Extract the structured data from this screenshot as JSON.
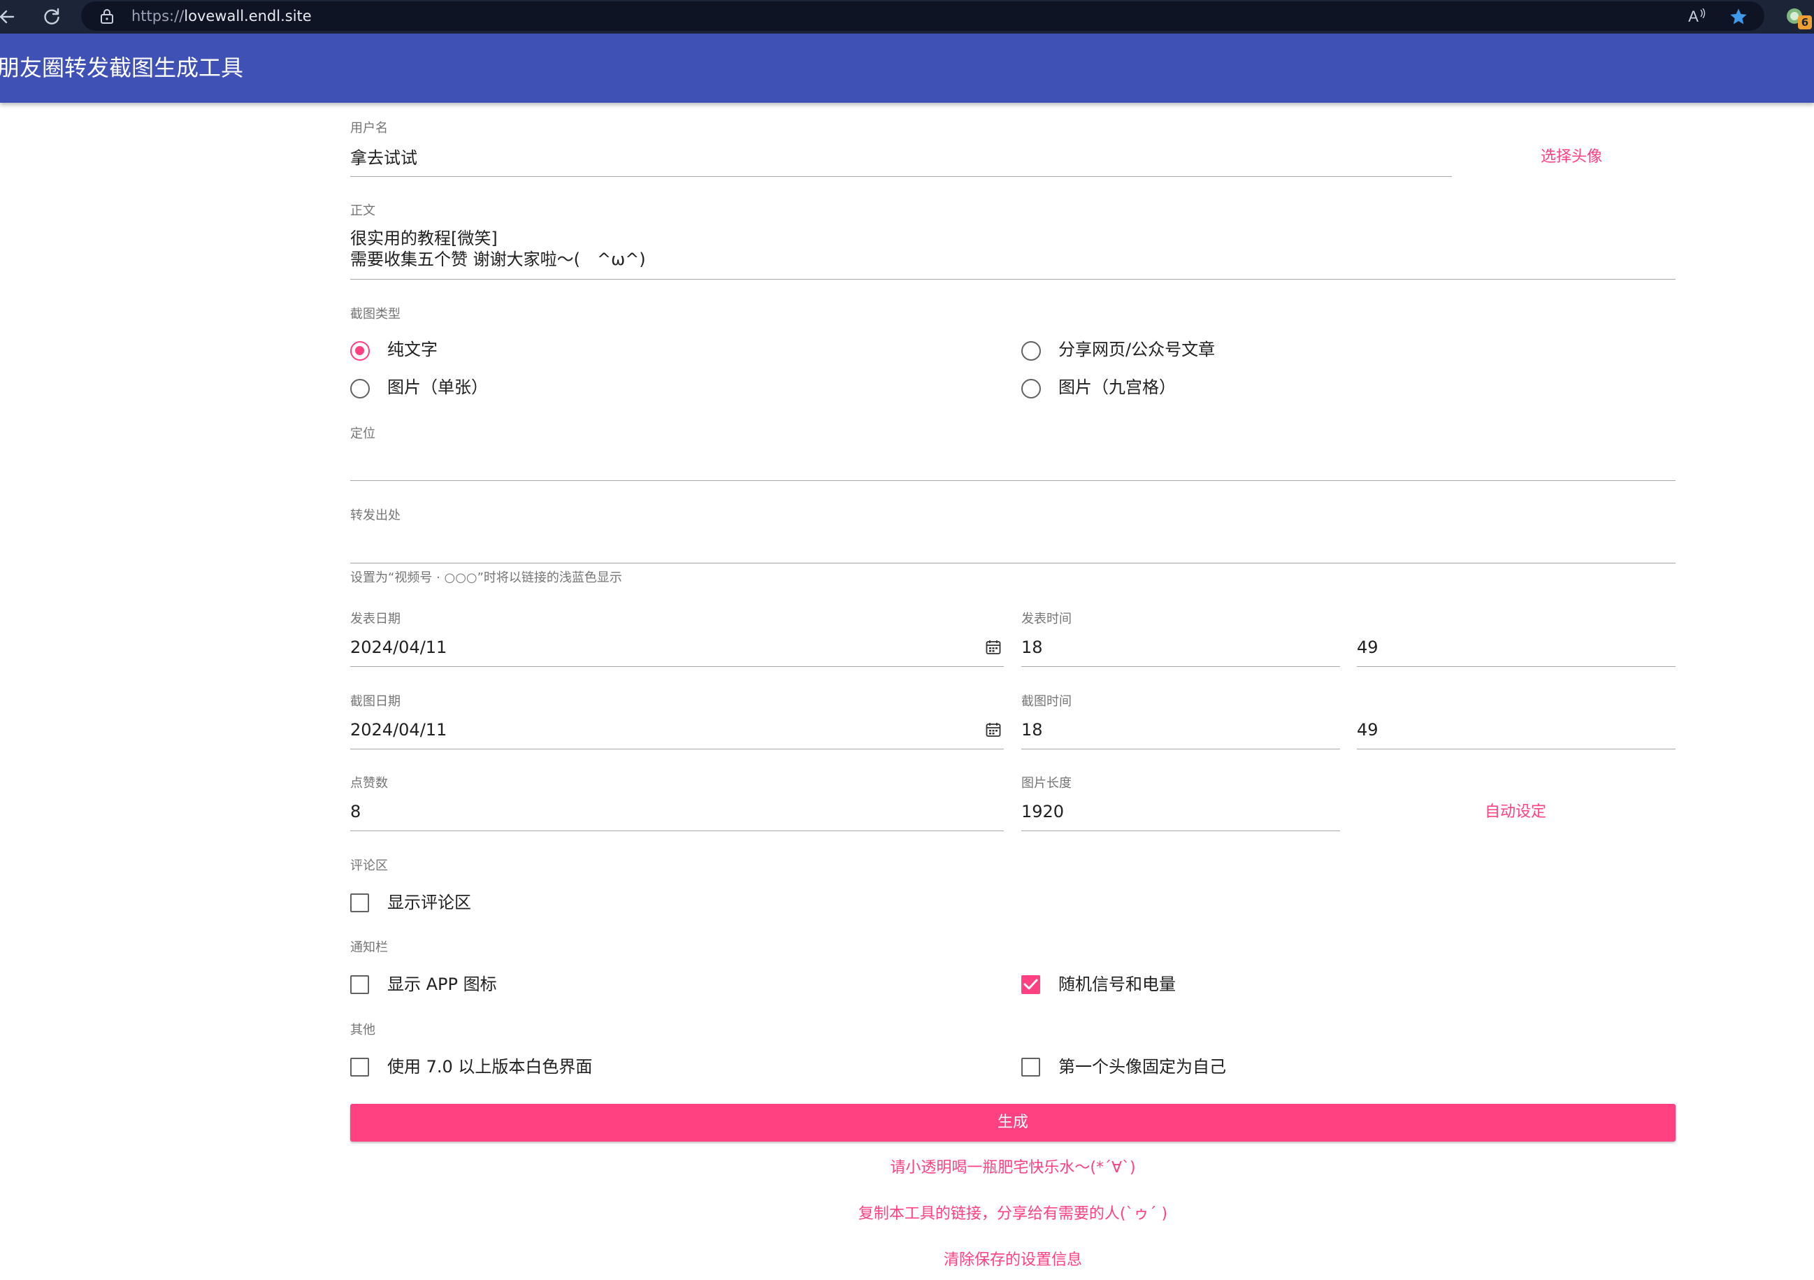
{
  "browser": {
    "url_protocol": "https://",
    "url_host": "lovewall.endl.site",
    "read_aloud_label": "A",
    "extension_badge": "6"
  },
  "app": {
    "title": "朋友圈转发截图生成工具"
  },
  "form": {
    "username": {
      "label": "用户名",
      "value": "拿去试试",
      "avatar_link": "选择头像"
    },
    "content": {
      "label": "正文",
      "line1": "很实用的教程[微笑]",
      "line2": "需要收集五个赞 谢谢大家啦～(　^ω^)"
    },
    "screenshot_type": {
      "label": "截图类型",
      "options": [
        "纯文字",
        "分享网页/公众号文章",
        "图片（单张）",
        "图片（九宫格）"
      ],
      "selected": "纯文字"
    },
    "location": {
      "label": "定位",
      "value": ""
    },
    "source": {
      "label": "转发出处",
      "value": "",
      "helper": "设置为“视频号 · ○○○”时将以链接的浅蓝色显示"
    },
    "publish_date": {
      "label": "发表日期",
      "value": "2024/04/11"
    },
    "publish_time": {
      "label": "发表时间",
      "hour": "18",
      "minute": "49"
    },
    "capture_date": {
      "label": "截图日期",
      "value": "2024/04/11"
    },
    "capture_time": {
      "label": "截图时间",
      "hour": "18",
      "minute": "49"
    },
    "likes": {
      "label": "点赞数",
      "value": "8"
    },
    "image_length": {
      "label": "图片长度",
      "value": "1920",
      "auto_link": "自动设定"
    },
    "comments": {
      "label": "评论区",
      "option": "显示评论区",
      "checked": false
    },
    "notification": {
      "label": "通知栏",
      "show_app_icon": {
        "text": "显示 APP 图标",
        "checked": false
      },
      "random_signal": {
        "text": "随机信号和电量",
        "checked": true
      }
    },
    "other": {
      "label": "其他",
      "white_ui": {
        "text": "使用 7.0 以上版本白色界面",
        "checked": false
      },
      "fixed_avatar": {
        "text": "第一个头像固定为自己",
        "checked": false
      }
    },
    "generate_label": "生成"
  },
  "footer": {
    "donate": "请小透明喝一瓶肥宅快乐水～(*´∀`)",
    "share": "复制本工具的链接，分享给有需要的人(`ゥ´ )",
    "clear": "清除保存的设置信息"
  },
  "colors": {
    "primary": "#3f51b5",
    "accent": "#ff4081",
    "chrome": "#1c2438"
  }
}
